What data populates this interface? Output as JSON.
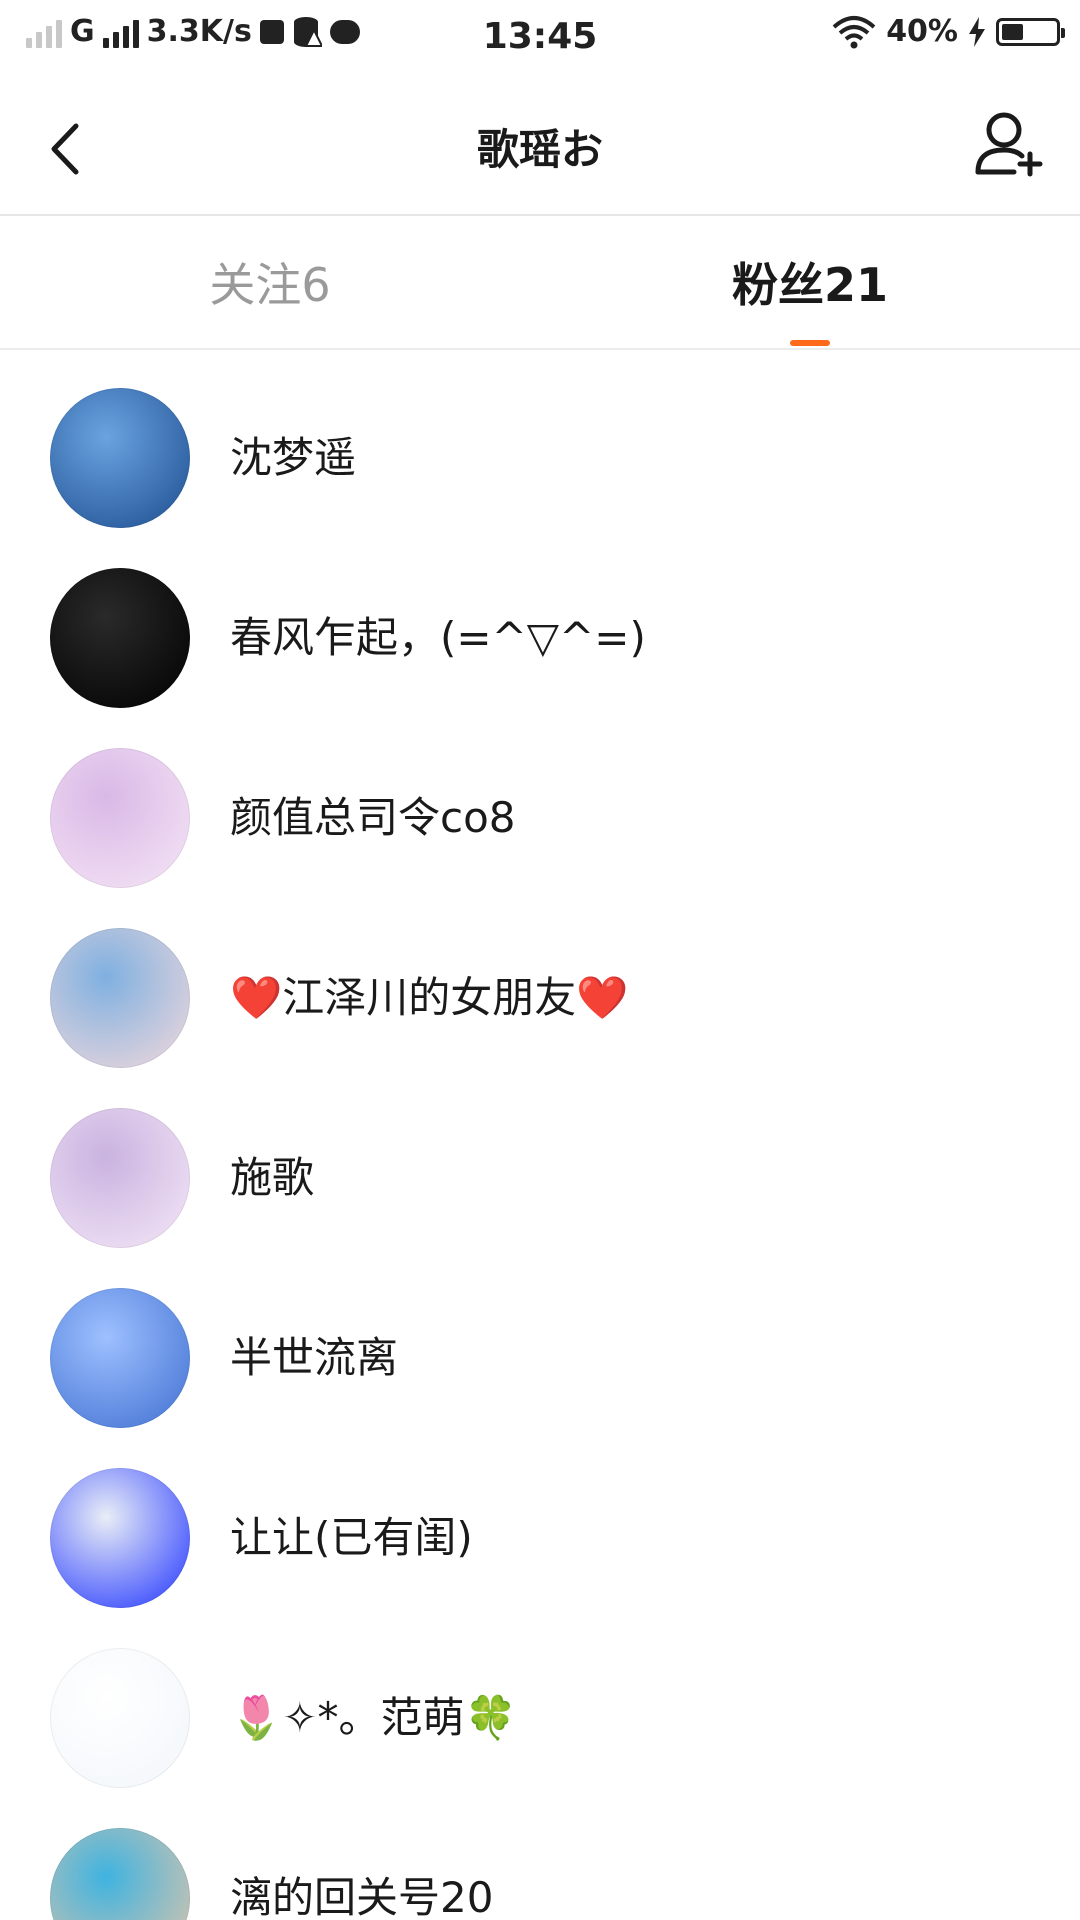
{
  "status_bar": {
    "carrier": "G",
    "speed": "3.3K/s",
    "time": "13:45",
    "battery": "40%",
    "battery_level": 0.4
  },
  "header": {
    "title": "歌瑶お",
    "back_icon": "chevron-left-icon",
    "add_user_icon": "add-user-icon"
  },
  "tabs": {
    "following": "关注6",
    "fans": "粉丝21",
    "active": "fans",
    "accent_color": "#ff6a1a"
  },
  "fans": [
    {
      "name": "沈梦遥",
      "avatar_colors": [
        "#1d4d8f",
        "#6aa3e0"
      ]
    },
    {
      "name": "春风乍起，(=^▽^=)",
      "avatar_colors": [
        "#000000",
        "#2a2a2a"
      ]
    },
    {
      "name": "颜值总司令co8",
      "avatar_colors": [
        "#f6e6f6",
        "#d9b8e6"
      ]
    },
    {
      "name": "❤️江泽川的女朋友❤️",
      "avatar_colors": [
        "#f3d9dc",
        "#7fb0e0"
      ]
    },
    {
      "name": "施歌",
      "avatar_colors": [
        "#f5e7f7",
        "#c9b3e0"
      ]
    },
    {
      "name": "半世流离",
      "avatar_colors": [
        "#3f6fd1",
        "#9ec0ff"
      ]
    },
    {
      "name": "让让(已有闺)",
      "avatar_colors": [
        "#1f33ff",
        "#e9eef6"
      ]
    },
    {
      "name": "🌷✧*。范萌🍀",
      "avatar_colors": [
        "#f2f6fb",
        "#ffffff"
      ]
    },
    {
      "name": "漓的回关号20",
      "avatar_colors": [
        "#e7c6a8",
        "#3fb3e0"
      ]
    }
  ]
}
